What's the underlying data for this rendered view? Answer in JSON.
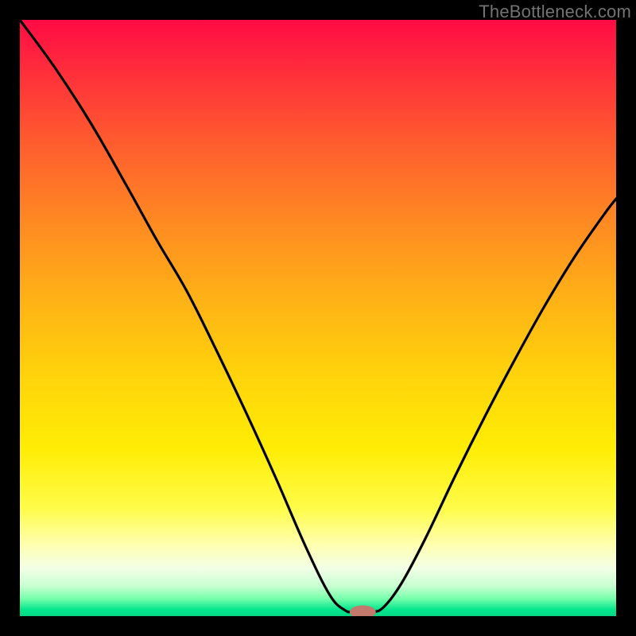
{
  "watermark": "TheBottleneck.com",
  "colors": {
    "background": "#000000",
    "curve": "#000000",
    "marker_fill": "#c37a6c",
    "gradient_stops": [
      "#ff0b44",
      "#ff2b3c",
      "#ff5a2f",
      "#ff8a22",
      "#ffb216",
      "#ffd40b",
      "#ffed05",
      "#fffc4a",
      "#ffffb0",
      "#f2ffe6",
      "#c7ffd0",
      "#7affad",
      "#00e58c",
      "#00d883"
    ]
  },
  "chart_data": {
    "type": "line",
    "title": "",
    "xlabel": "",
    "ylabel": "",
    "xlim": [
      0,
      100
    ],
    "ylim": [
      0,
      100
    ],
    "note": "Fractional coordinates (0–1) of the plotted bottleneck curve within the colored plot area. y=0 is the top edge, y=1 is the bottom edge. Values are visually estimated from the image.",
    "series": [
      {
        "name": "bottleneck-curve",
        "points": [
          {
            "x": 0.0,
            "y": 0.0
          },
          {
            "x": 0.06,
            "y": 0.082
          },
          {
            "x": 0.12,
            "y": 0.175
          },
          {
            "x": 0.18,
            "y": 0.28
          },
          {
            "x": 0.23,
            "y": 0.37
          },
          {
            "x": 0.28,
            "y": 0.455
          },
          {
            "x": 0.33,
            "y": 0.555
          },
          {
            "x": 0.38,
            "y": 0.66
          },
          {
            "x": 0.43,
            "y": 0.77
          },
          {
            "x": 0.48,
            "y": 0.885
          },
          {
            "x": 0.52,
            "y": 0.965
          },
          {
            "x": 0.545,
            "y": 0.99
          },
          {
            "x": 0.56,
            "y": 0.993
          },
          {
            "x": 0.59,
            "y": 0.993
          },
          {
            "x": 0.61,
            "y": 0.985
          },
          {
            "x": 0.64,
            "y": 0.945
          },
          {
            "x": 0.68,
            "y": 0.87
          },
          {
            "x": 0.73,
            "y": 0.765
          },
          {
            "x": 0.78,
            "y": 0.665
          },
          {
            "x": 0.83,
            "y": 0.57
          },
          {
            "x": 0.88,
            "y": 0.48
          },
          {
            "x": 0.93,
            "y": 0.398
          },
          {
            "x": 0.98,
            "y": 0.326
          },
          {
            "x": 1.0,
            "y": 0.3
          }
        ]
      }
    ],
    "marker": {
      "x": 0.575,
      "y": 0.993,
      "rx": 0.022,
      "ry": 0.011
    }
  }
}
